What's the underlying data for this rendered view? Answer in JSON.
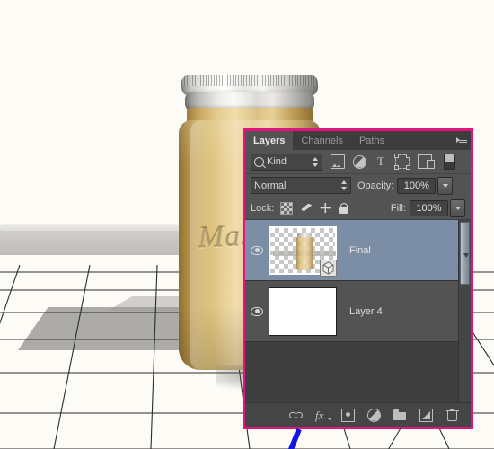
{
  "scene": {
    "description": "3d-rendered-mason-jar-on-perspective-grid",
    "jar_emboss_text": "Mas",
    "background_color": "#fcfbf6",
    "jar_color": "#e0c487",
    "lid_color": "#e8e7e4",
    "grid_line_color": "#2a2a2a"
  },
  "panel": {
    "highlight_border_color": "#e8127e",
    "background_color": "#535353",
    "tabs": [
      {
        "label": "Layers",
        "active": true
      },
      {
        "label": "Channels",
        "active": false
      },
      {
        "label": "Paths",
        "active": false
      }
    ],
    "menu_icon": "panel-menu-icon",
    "filter": {
      "kind_label": "Kind",
      "search_icon": "magnifier-icon",
      "icons": [
        "pixel-layer-filter-icon",
        "adjustment-layer-filter-icon",
        "type-layer-filter-icon",
        "shape-layer-filter-icon",
        "smart-object-filter-icon",
        "filter-toggle-switch"
      ],
      "type_glyph": "T"
    },
    "blend": {
      "mode": "Normal",
      "opacity_label": "Opacity:",
      "opacity_value": "100%"
    },
    "lock": {
      "label": "Lock:",
      "icons": [
        "lock-transparent-pixels-icon",
        "lock-image-pixels-icon",
        "lock-position-icon",
        "lock-all-icon"
      ],
      "fill_label": "Fill:",
      "fill_value": "100%"
    },
    "layers": [
      {
        "name": "Final",
        "selected": true,
        "visible": true,
        "thumb_type": "transparent-jar",
        "badge": "3d-object-badge"
      },
      {
        "name": "Layer 4",
        "selected": false,
        "visible": true,
        "thumb_type": "white",
        "badge": ""
      }
    ],
    "scrollbar": {
      "present": true,
      "arrow": "scroll-down-arrow"
    },
    "toolbar_buttons": [
      "link-layers-icon",
      "add-layer-style-icon",
      "add-layer-mask-icon",
      "new-adjustment-layer-icon",
      "new-group-icon",
      "new-layer-icon",
      "delete-layer-icon"
    ],
    "fx_label": "fx"
  },
  "annotations": {
    "blue_line": "blue-callout-line",
    "dark_line": "dark-grid-line"
  }
}
